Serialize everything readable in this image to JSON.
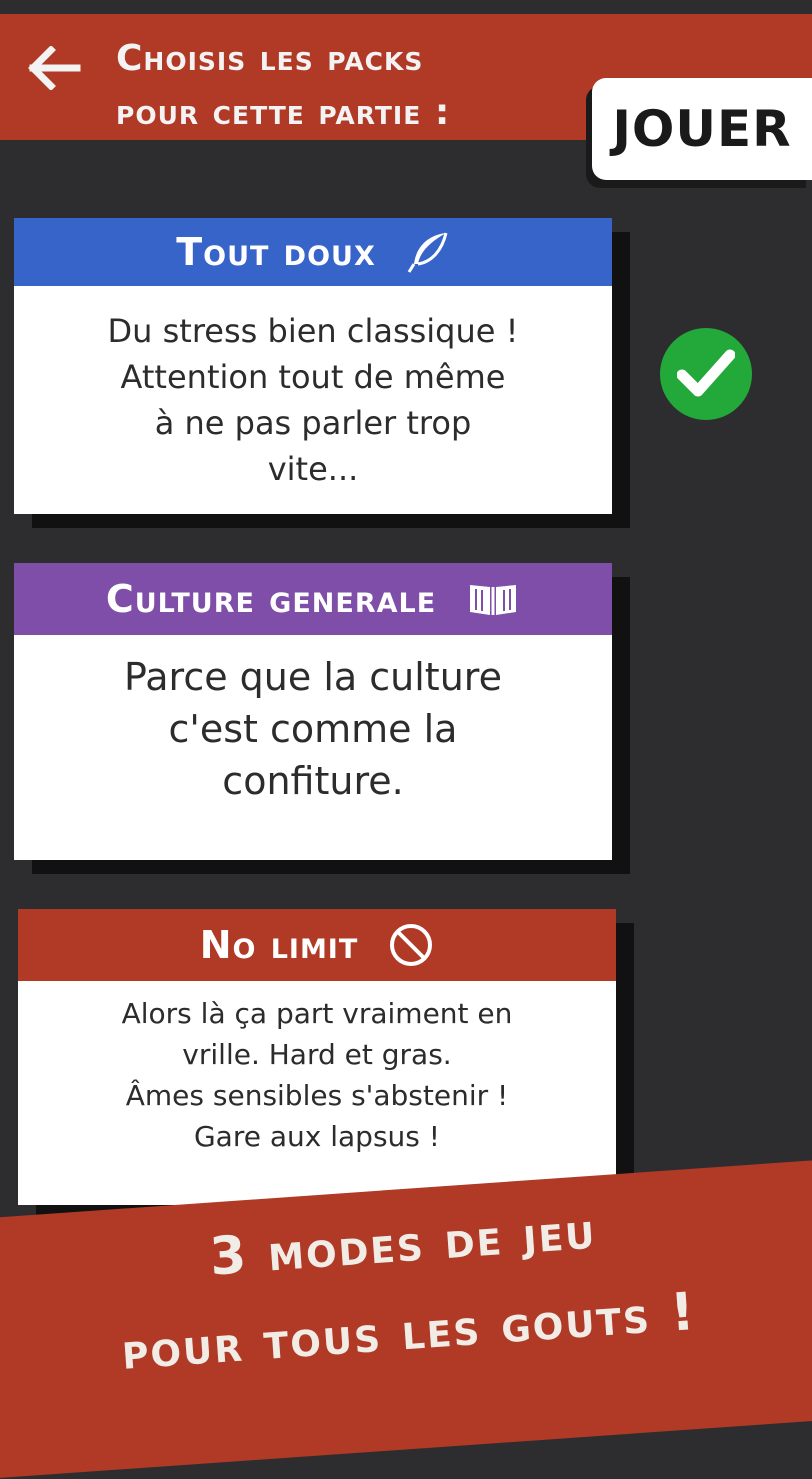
{
  "header": {
    "title_line1": "Choisis les packs",
    "title_line2": "pour cette partie :",
    "play_label": "JOUER"
  },
  "packs": [
    {
      "title": "Tout doux",
      "icon": "feather-icon",
      "color": "#3664c8",
      "description": "Du stress bien classique !\nAttention tout de même\nà ne pas parler trop\nvite...",
      "selected": true
    },
    {
      "title": "Culture generale",
      "icon": "book-icon",
      "color": "#7e4ea8",
      "description": "Parce que la culture\nc'est comme la\nconfiture.",
      "selected": false
    },
    {
      "title": "No limit",
      "icon": "forbidden-icon",
      "color": "#b03a26",
      "description": "Alors là ça part vraiment en\nvrille. Hard et gras.\nÂmes sensibles s'abstenir !\nGare aux lapsus !",
      "selected": false
    }
  ],
  "banner": {
    "line1": "3 modes de jeu",
    "line2": "pour tous les gouts !"
  },
  "colors": {
    "background": "#2d2d2f",
    "accent_red": "#b03a26",
    "check_green": "#23a83a"
  }
}
